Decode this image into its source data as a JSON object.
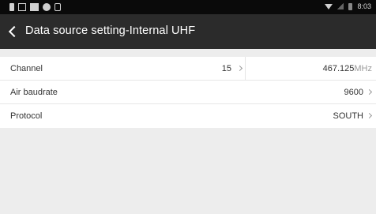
{
  "status_bar": {
    "time": "8:03",
    "left_icons": [
      "battery-small-icon",
      "image-icon",
      "square-icon",
      "circle-icon",
      "lock-icon"
    ],
    "right_icons": [
      "wifi-icon",
      "signal-icon",
      "battery-icon"
    ]
  },
  "header": {
    "title": "Data source setting-Internal UHF",
    "back_icon": "chevron-left-icon"
  },
  "rows": {
    "channel": {
      "label": "Channel",
      "value": "15",
      "frequency": "467.125",
      "unit": "MHz"
    },
    "air_baudrate": {
      "label": "Air baudrate",
      "value": "9600"
    },
    "protocol": {
      "label": "Protocol",
      "value": "SOUTH"
    }
  },
  "colors": {
    "appbar": "#2b2b2b",
    "statusbar": "#0a0a0a",
    "background": "#ededed"
  }
}
